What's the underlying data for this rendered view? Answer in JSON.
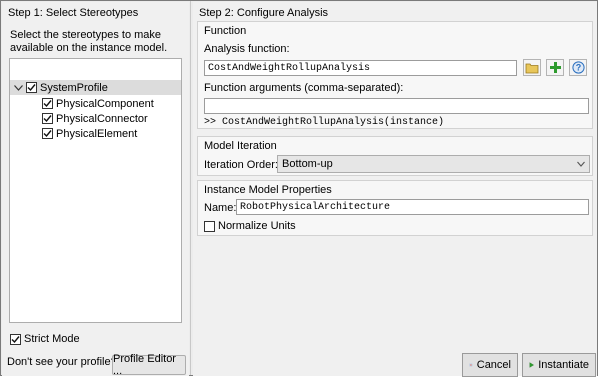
{
  "left_panel": {
    "title": "Step 1: Select Stereotypes",
    "description": "Select the stereotypes to make available on the instance model.",
    "tree": {
      "root": {
        "label": "SystemProfile",
        "checked": true,
        "expanded": true
      },
      "children": [
        {
          "label": "PhysicalComponent",
          "checked": true
        },
        {
          "label": "PhysicalConnector",
          "checked": true
        },
        {
          "label": "PhysicalElement",
          "checked": true
        }
      ]
    },
    "strict_mode_label": "Strict Mode",
    "strict_mode_checked": true,
    "profile_prompt": "Don't see your profile?",
    "profile_editor_button": "Profile Editor ..."
  },
  "right_panel": {
    "title": "Step 2: Configure Analysis",
    "function_section": {
      "heading": "Function",
      "analysis_function_label": "Analysis function:",
      "analysis_function_value": "CostAndWeightRollupAnalysis",
      "arguments_label": "Function arguments (comma-separated):",
      "arguments_value": "",
      "preview": ">> CostAndWeightRollupAnalysis(instance)"
    },
    "iteration_section": {
      "heading": "Model Iteration",
      "order_label": "Iteration Order:",
      "order_value": "Bottom-up"
    },
    "instance_section": {
      "heading": "Instance Model Properties",
      "name_label": "Name:",
      "name_value": "RobotPhysicalArchitecture",
      "normalize_label": "Normalize Units",
      "normalize_checked": false
    }
  },
  "footer": {
    "cancel_label": "Cancel",
    "instantiate_label": "Instantiate"
  },
  "colors": {
    "accent_green": "#2e9b2e",
    "cancel_red": "#c0392b",
    "help_blue": "#2a6fbf",
    "folder_yellow": "#e8c65a"
  }
}
